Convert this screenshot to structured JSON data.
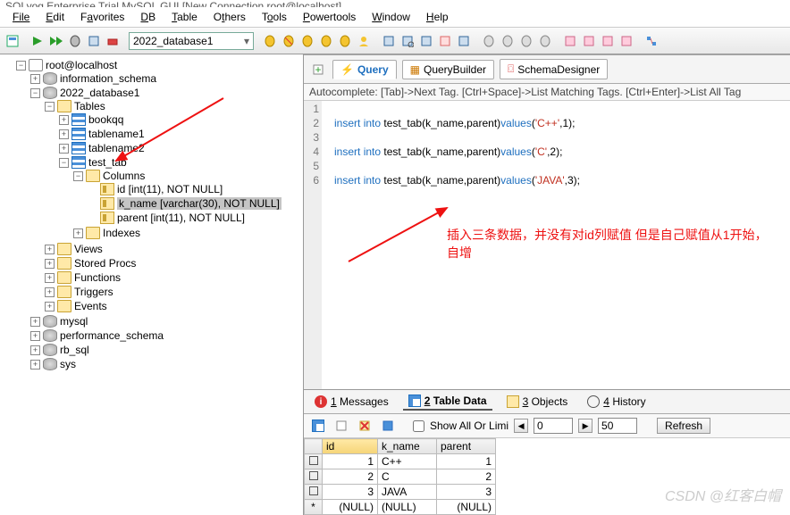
{
  "title": "SQLyog Enterprise Trial   MySQL GUI   [New Connection   root@localhost]",
  "menu": [
    "File",
    "Edit",
    "Favorites",
    "DB",
    "Table",
    "Others",
    "Tools",
    "Powertools",
    "Window",
    "Help"
  ],
  "db_combo": "2022_database1",
  "tree": {
    "root": "root@localhost",
    "dbs": [
      {
        "name": "information_schema",
        "expandable": true
      },
      {
        "name": "2022_database1",
        "expanded": true,
        "children": [
          {
            "name": "Tables",
            "type": "folder",
            "expanded": true,
            "children": [
              {
                "name": "bookqq",
                "type": "table",
                "expandable": true
              },
              {
                "name": "tablename1",
                "type": "table",
                "expandable": true
              },
              {
                "name": "tablename2",
                "type": "table",
                "expandable": true
              },
              {
                "name": "test_tab",
                "type": "table",
                "expanded": true,
                "children": [
                  {
                    "name": "Columns",
                    "type": "folder",
                    "expanded": true,
                    "children": [
                      {
                        "name": "id [int(11), NOT NULL]",
                        "type": "col"
                      },
                      {
                        "name": "k_name [varchar(30), NOT NULL]",
                        "type": "col",
                        "selected": true
                      },
                      {
                        "name": "parent [int(11), NOT NULL]",
                        "type": "col"
                      }
                    ]
                  },
                  {
                    "name": "Indexes",
                    "type": "folder",
                    "expandable": true
                  }
                ]
              }
            ]
          },
          {
            "name": "Views",
            "type": "folder",
            "expandable": true
          },
          {
            "name": "Stored Procs",
            "type": "folder",
            "expandable": true
          },
          {
            "name": "Functions",
            "type": "folder",
            "expandable": true
          },
          {
            "name": "Triggers",
            "type": "folder",
            "expandable": true
          },
          {
            "name": "Events",
            "type": "folder",
            "expandable": true
          }
        ]
      },
      {
        "name": "mysql",
        "expandable": true
      },
      {
        "name": "performance_schema",
        "expandable": true
      },
      {
        "name": "rb_sql",
        "expandable": true
      },
      {
        "name": "sys",
        "expandable": true
      }
    ]
  },
  "editor_tabs": [
    {
      "label": "Query",
      "active": true,
      "icon": "lightning"
    },
    {
      "label": "QueryBuilder",
      "icon": "blocks"
    },
    {
      "label": "SchemaDesigner",
      "icon": "schema"
    }
  ],
  "autocomplete_hint": "Autocomplete: [Tab]->Next Tag. [Ctrl+Space]->List Matching Tags. [Ctrl+Enter]->List All Tag",
  "code_lines": [
    {
      "n": 1,
      "text": ""
    },
    {
      "n": 2,
      "tokens": [
        [
          "kw",
          "insert"
        ],
        [
          "sp",
          " "
        ],
        [
          "kw",
          "into"
        ],
        [
          "sp",
          " "
        ],
        [
          "id",
          "test_tab(k_name,parent)"
        ],
        [
          "fn",
          "values"
        ],
        [
          "id",
          "("
        ],
        [
          "str",
          "'C++'"
        ],
        [
          "id",
          ",1);"
        ]
      ]
    },
    {
      "n": 3,
      "text": ""
    },
    {
      "n": 4,
      "tokens": [
        [
          "kw",
          "insert"
        ],
        [
          "sp",
          " "
        ],
        [
          "kw",
          "into"
        ],
        [
          "sp",
          " "
        ],
        [
          "id",
          "test_tab(k_name,parent)"
        ],
        [
          "fn",
          "values"
        ],
        [
          "id",
          "("
        ],
        [
          "str",
          "'C'"
        ],
        [
          "id",
          ",2);"
        ]
      ]
    },
    {
      "n": 5,
      "text": ""
    },
    {
      "n": 6,
      "tokens": [
        [
          "kw",
          "insert"
        ],
        [
          "sp",
          " "
        ],
        [
          "kw",
          "into"
        ],
        [
          "sp",
          " "
        ],
        [
          "id",
          "test_tab(k_name,parent)"
        ],
        [
          "fn",
          "values"
        ],
        [
          "id",
          "("
        ],
        [
          "str",
          "'JAVA'"
        ],
        [
          "id",
          ",3);"
        ]
      ]
    }
  ],
  "annotation_text": "插入三条数据，并没有对id列赋值 但是自己赋值从1开始，自增",
  "result_tabs": [
    {
      "key": "1",
      "label": "Messages",
      "icon": "info"
    },
    {
      "key": "2",
      "label": "Table Data",
      "icon": "grid",
      "active": true
    },
    {
      "key": "3",
      "label": "Objects",
      "icon": "obj"
    },
    {
      "key": "4",
      "label": "History",
      "icon": "hist"
    }
  ],
  "res_tools": {
    "show_all_label": "Show All Or Limi",
    "offset": "0",
    "limit": "50",
    "refresh": "Refresh"
  },
  "grid": {
    "columns": [
      "id",
      "k_name",
      "parent"
    ],
    "rows": [
      {
        "id": "1",
        "k_name": "C++",
        "parent": "1"
      },
      {
        "id": "2",
        "k_name": "C",
        "parent": "2"
      },
      {
        "id": "3",
        "k_name": "JAVA",
        "parent": "3"
      }
    ],
    "null_row": {
      "mark": "*",
      "id": "(NULL)",
      "k_name": "(NULL)",
      "parent": "(NULL)"
    }
  },
  "watermark": "CSDN @红客白帽"
}
